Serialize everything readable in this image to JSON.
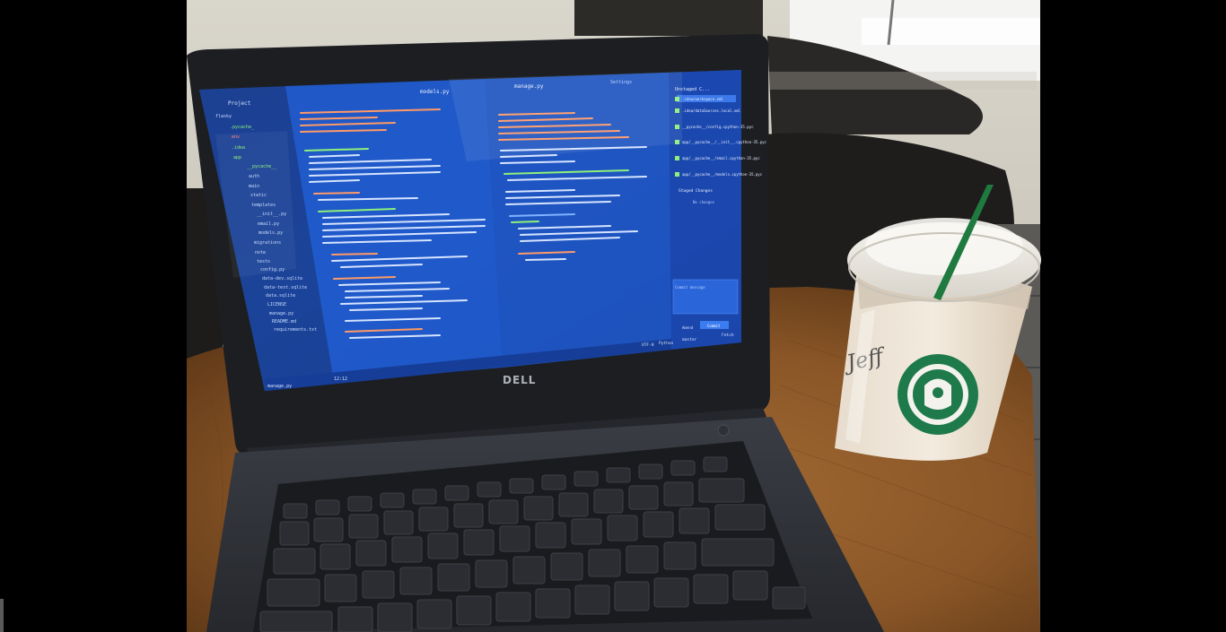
{
  "photo": {
    "laptop": {
      "brand": "DELL",
      "ide": {
        "panel_title": "Project",
        "tab_models": "models.py",
        "tab_manage": "manage.py",
        "tab_settings": "Settings",
        "git_panel_title": "Unstaged C...",
        "staged_label": "Staged Changes",
        "no_changes": "No changes",
        "commit_placeholder": "Commit message",
        "amend_label": "Amend",
        "commit_button": "Commit",
        "status_file": "manage.py",
        "status_pos": "12:12",
        "status_encoding": "UTF-8",
        "status_lang": "Python",
        "status_branch": "master",
        "status_fetch": "Fetch",
        "tree": [
          "flasky",
          ".pycache_",
          "env",
          ".idea",
          "app",
          "__pycache__",
          "auth",
          "main",
          "static",
          "templates",
          "__init__.py",
          "email.py",
          "models.py",
          "migrations",
          "note",
          "tests",
          "config.py",
          "data-dev.sqlite",
          "data-test.sqlite",
          "data.sqlite",
          "LICENSE",
          "manage.py",
          "README.md",
          "requirements.txt"
        ],
        "git_files": [
          ".idea/workspace.xml",
          ".idea/dataSources.local.xml",
          "__pycache__/config.cpython-35.pyc",
          "app/__pycache__/__init__.cpython-35.pyc",
          "app/__pycache__/email.cpython-35.pyc",
          "app/__pycache__/models.cpython-35.pyc"
        ]
      }
    },
    "cup": {
      "handwriting": "Jeff"
    }
  },
  "colors": {
    "background": "#000000",
    "screen_blue": "#1f5fd0",
    "wood": "#8a5a2c",
    "laptop_body": "#2a2d33",
    "starbucks_green": "#1e7a4a"
  }
}
